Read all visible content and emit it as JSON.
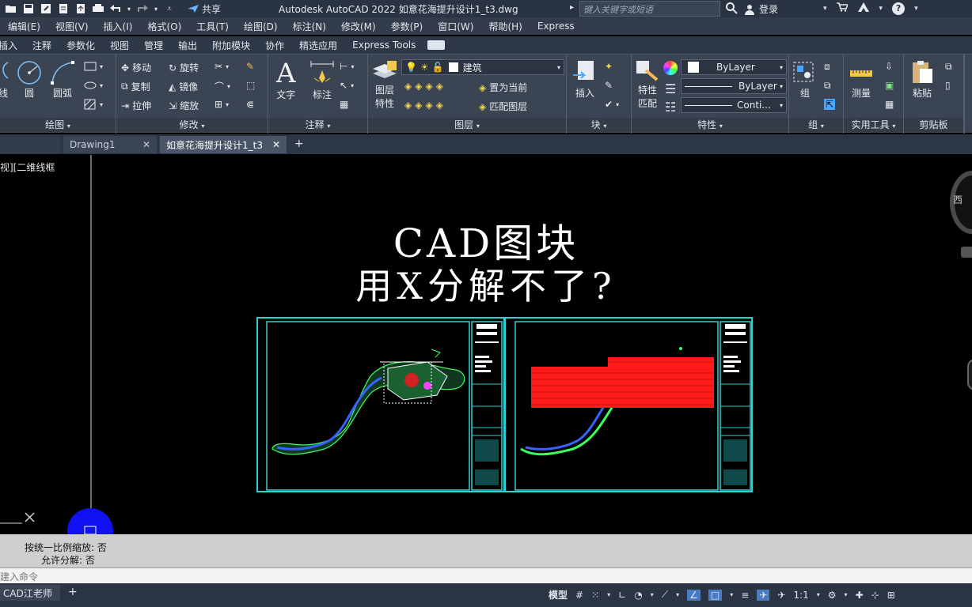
{
  "titlebar": {
    "share_label": "共享",
    "title": "Autodesk AutoCAD 2022    如意花海提升设计1_t3.dwg",
    "search_placeholder": "键入关键字或短语",
    "login_label": "登录"
  },
  "menubar": {
    "items": [
      "编辑(E)",
      "视图(V)",
      "插入(I)",
      "格式(O)",
      "工具(T)",
      "绘图(D)",
      "标注(N)",
      "修改(M)",
      "参数(P)",
      "窗口(W)",
      "帮助(H)",
      "Express"
    ]
  },
  "ribbon_tabs": {
    "items": [
      "插入",
      "注释",
      "参数化",
      "视图",
      "管理",
      "输出",
      "附加模块",
      "协作",
      "精选应用",
      "Express Tools"
    ]
  },
  "ribbon": {
    "draw": {
      "title": "绘图",
      "line_label": "线",
      "circle_label": "圆",
      "arc_label": "圆弧"
    },
    "modify": {
      "title": "修改",
      "move": "移动",
      "rotate": "旋转",
      "copy": "复制",
      "mirror": "镜像",
      "stretch": "拉伸",
      "scale": "缩放"
    },
    "annotation": {
      "title": "注释",
      "text": "文字",
      "dimension": "标注"
    },
    "layers": {
      "title": "图层",
      "props_line1": "图层",
      "props_line2": "特性",
      "layer_name": "建筑",
      "set_current": "置为当前",
      "match_layer": "匹配图层"
    },
    "block": {
      "title": "块",
      "insert": "插入"
    },
    "properties": {
      "title": "特性",
      "match_line1": "特性",
      "match_line2": "匹配",
      "color": "ByLayer",
      "linetype": "ByLayer",
      "lineweight": "Conti..."
    },
    "groups": {
      "title": "组",
      "group": "组"
    },
    "utilities": {
      "title": "实用工具",
      "measure": "测量"
    },
    "clipboard": {
      "title": "剪贴板",
      "paste": "粘贴"
    }
  },
  "doc_tabs": {
    "tab1": "Drawing1",
    "tab2": "如意花海提升设计1_t3"
  },
  "canvas": {
    "view_label": "视][二维线框",
    "overlay_line1": "CAD图块",
    "overlay_line2": "用X分解不了?",
    "viewcube_label": "西"
  },
  "command": {
    "history_line1": "按统一比例缩放: 否",
    "history_line2": "允许分解: 否",
    "input_placeholder": "建入命令"
  },
  "statusbar": {
    "layout_tab": "CAD江老师",
    "model_label": "模型",
    "scale_label": "1:1"
  },
  "colors": {
    "title_bg": "#293342",
    "ribbon_bg": "#3b4453",
    "canvas_bg": "#000000",
    "frame_cyan": "#2fd0d0",
    "hatch_red": "#ff1a1a",
    "cursor_blue": "#1010f0"
  }
}
